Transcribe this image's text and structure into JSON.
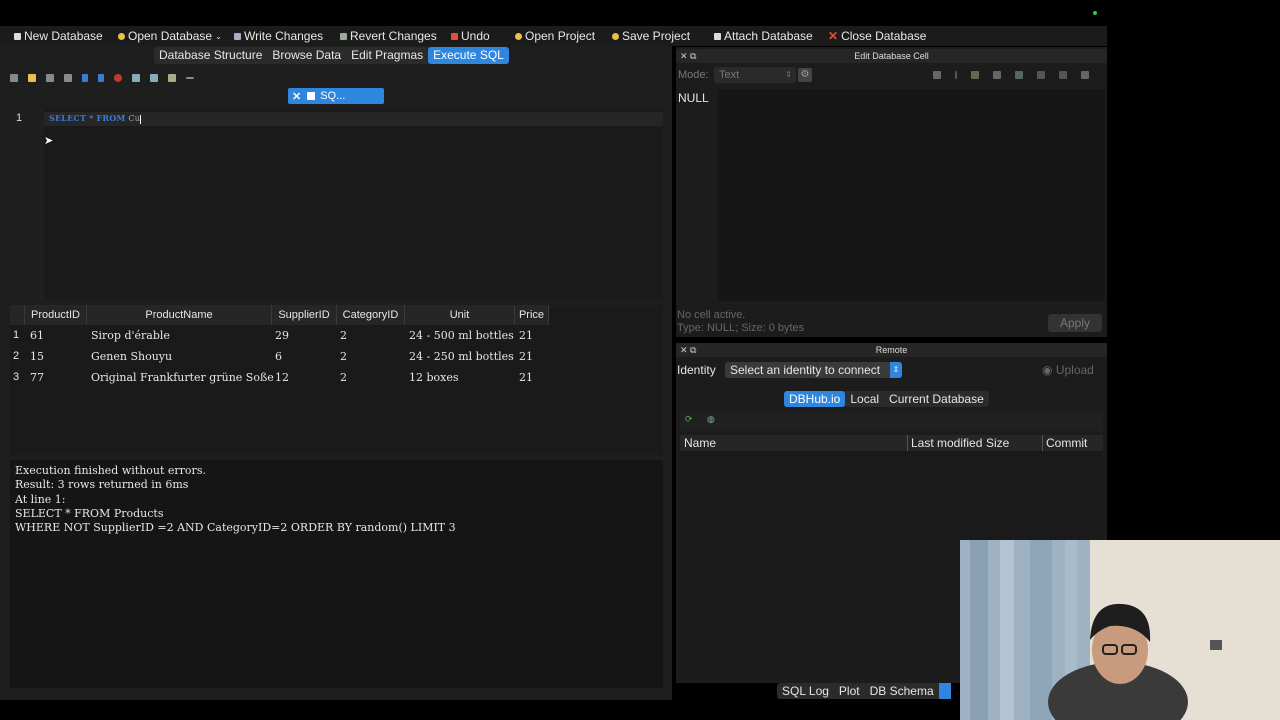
{
  "toolbar": {
    "new_database": "New Database",
    "open_database": "Open Database",
    "write_changes": "Write Changes",
    "revert_changes": "Revert Changes",
    "undo": "Undo",
    "open_project": "Open Project",
    "save_project": "Save Project",
    "attach_database": "Attach Database",
    "close_database": "Close Database"
  },
  "tabs": [
    "Database Structure",
    "Browse Data",
    "Edit Pragmas",
    "Execute SQL"
  ],
  "active_tab": "Execute SQL",
  "editor": {
    "tab_label": "SQ...",
    "line_number": "1",
    "code_keywords": "SELECT * FROM ",
    "code_tail": "Cu"
  },
  "results": {
    "columns": [
      "ProductID",
      "ProductName",
      "SupplierID",
      "CategoryID",
      "Unit",
      "Price"
    ],
    "rows": [
      {
        "n": "1",
        "cells": [
          "61",
          "Sirop d'érable",
          "29",
          "2",
          "24 - 500 ml bottles",
          "21"
        ]
      },
      {
        "n": "2",
        "cells": [
          "15",
          "Genen Shouyu",
          "6",
          "2",
          "24 - 250 ml bottles",
          "21"
        ]
      },
      {
        "n": "3",
        "cells": [
          "77",
          "Original Frankfurter grüne Soße",
          "12",
          "2",
          "12 boxes",
          "21"
        ]
      }
    ]
  },
  "messages": [
    "Execution finished without errors.",
    "Result: 3 rows returned in 6ms",
    "At line 1:",
    "SELECT * FROM Products",
    "WHERE  NOT SupplierID =2 AND CategoryID=2 ORDER BY random() LIMIT 3"
  ],
  "cell_panel": {
    "title": "Edit Database Cell",
    "mode_label": "Mode:",
    "mode_value": "Text",
    "value": "NULL",
    "status1": "No cell active.",
    "status2": "Type: NULL; Size: 0 bytes",
    "apply": "Apply"
  },
  "remote_panel": {
    "title": "Remote",
    "identity_label": "Identity",
    "identity_select": "Select an identity to connect",
    "upload": "Upload",
    "segments": [
      "DBHub.io",
      "Local",
      "Current Database"
    ],
    "columns": [
      "Name",
      "Last modified",
      "Size",
      "Commit"
    ]
  },
  "bottom_tabs": [
    "SQL Log",
    "Plot",
    "DB Schema"
  ],
  "colors": {
    "accent": "#2e86de",
    "close_red": "#e74c3c"
  }
}
